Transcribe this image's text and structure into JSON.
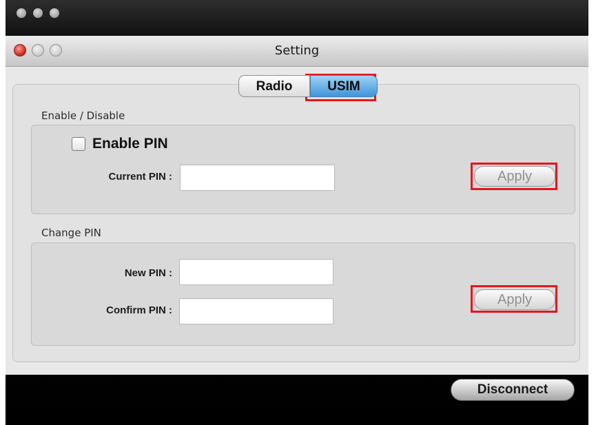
{
  "window": {
    "title": "Setting"
  },
  "tabs": [
    {
      "label": "Radio",
      "selected": false
    },
    {
      "label": "USIM",
      "selected": true
    }
  ],
  "enable_section": {
    "label": "Enable / Disable",
    "checkbox_label": "Enable PIN",
    "checkbox_checked": false,
    "current_pin_label": "Current PIN :",
    "current_pin_value": "",
    "apply_label": "Apply"
  },
  "change_section": {
    "label": "Change PIN",
    "new_pin_label": "New PIN :",
    "new_pin_value": "",
    "confirm_pin_label": "Confirm PIN :",
    "confirm_pin_value": "",
    "apply_label": "Apply"
  },
  "footer": {
    "disconnect_label": "Disconnect"
  },
  "colors": {
    "highlight": "#e6151c",
    "selected_tab": "#3f95d8"
  }
}
